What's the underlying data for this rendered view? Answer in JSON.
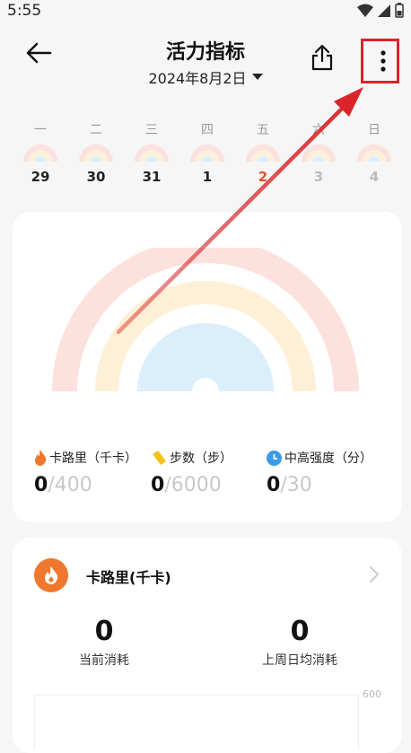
{
  "status_bar": {
    "time": "5:55"
  },
  "header": {
    "title": "活力指标",
    "date": "2024年8月2日",
    "dropdown_icon": "caret-down-icon",
    "back_icon": "arrow-left-icon",
    "share_icon": "share-icon",
    "more_icon": "more-vertical-icon"
  },
  "week": [
    {
      "name": "一",
      "num": "29"
    },
    {
      "name": "二",
      "num": "30"
    },
    {
      "name": "三",
      "num": "31"
    },
    {
      "name": "四",
      "num": "1"
    },
    {
      "name": "五",
      "num": "2"
    },
    {
      "name": "六",
      "num": "3"
    },
    {
      "name": "日",
      "num": "4"
    }
  ],
  "metrics": [
    {
      "label": "卡路里（千卡）",
      "current": "0",
      "goal": "/400",
      "icon": "flame-icon",
      "color": "#f0772e"
    },
    {
      "label": "步数（步）",
      "current": "0",
      "goal": "/6000",
      "icon": "shoe-icon",
      "color": "#f3c21a"
    },
    {
      "label": "中高强度（分）",
      "current": "0",
      "goal": "/30",
      "icon": "clock-icon",
      "color": "#3b9be6"
    }
  ],
  "rainbow_colors": {
    "outer": "#fde1dc",
    "middle": "#fdf0d6",
    "inner": "#daeefc"
  },
  "calorie_card": {
    "title": "卡路里(千卡)",
    "current_value": "0",
    "current_label": "当前消耗",
    "last_week_value": "0",
    "last_week_label": "上周日均消耗",
    "axis_max": "600"
  },
  "annotation_color": "#d9252a"
}
